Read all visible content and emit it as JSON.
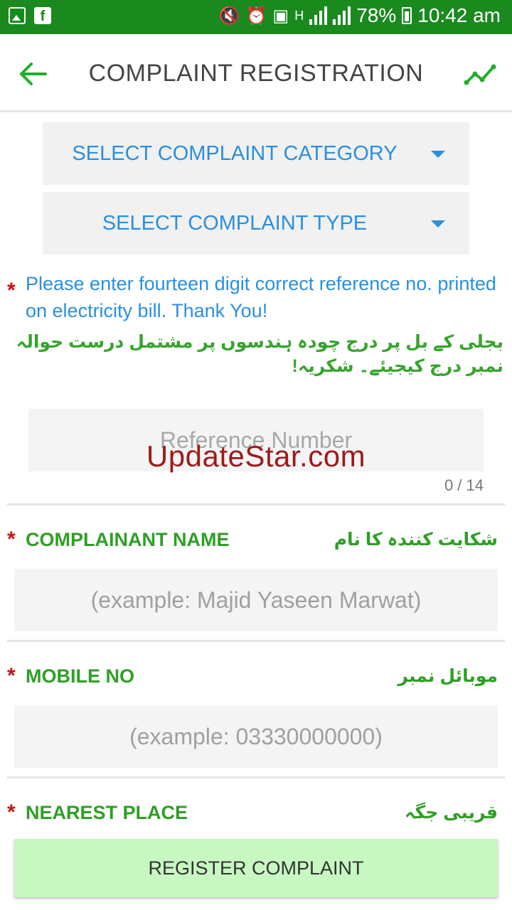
{
  "status_bar": {
    "battery": "78%",
    "time": "10:42 am",
    "network_type": "H"
  },
  "app_bar": {
    "title": "COMPLAINT REGISTRATION",
    "back_icon": "arrow-left-icon",
    "right_icon": "trending-up-icon"
  },
  "dropdowns": {
    "category": "SELECT COMPLAINT CATEGORY",
    "type": "SELECT COMPLAINT TYPE"
  },
  "notice": {
    "english": "Please enter fourteen digit correct reference no. printed on electricity bill. Thank You!",
    "urdu": "بجلی کے بل پر درج چودہ ہندسوں پر مشتمل درست حوالہ نمبر درج کیجیئے۔ شکریہ!"
  },
  "reference": {
    "placeholder": "Reference Number",
    "counter": "0 / 14"
  },
  "watermark": "UpdateStar.com",
  "fields": {
    "name": {
      "label": "COMPLAINANT NAME",
      "label_ur": "شکایت کنندہ کا نام",
      "placeholder": "(example: Majid Yaseen Marwat)"
    },
    "mobile": {
      "label": "MOBILE NO",
      "label_ur": "موبائل نمبر",
      "placeholder": "(example: 03330000000)"
    },
    "nearest": {
      "label": "NEAREST PLACE",
      "label_ur": "قریبی جگہ"
    }
  },
  "register_button": "REGISTER COMPLAINT",
  "colors": {
    "status_bar": "#1a8a1f",
    "accent_blue": "#2b8fe0",
    "label_green": "#2f9f26",
    "required_red": "#cc1111",
    "button_bg": "#c8f8c2"
  }
}
